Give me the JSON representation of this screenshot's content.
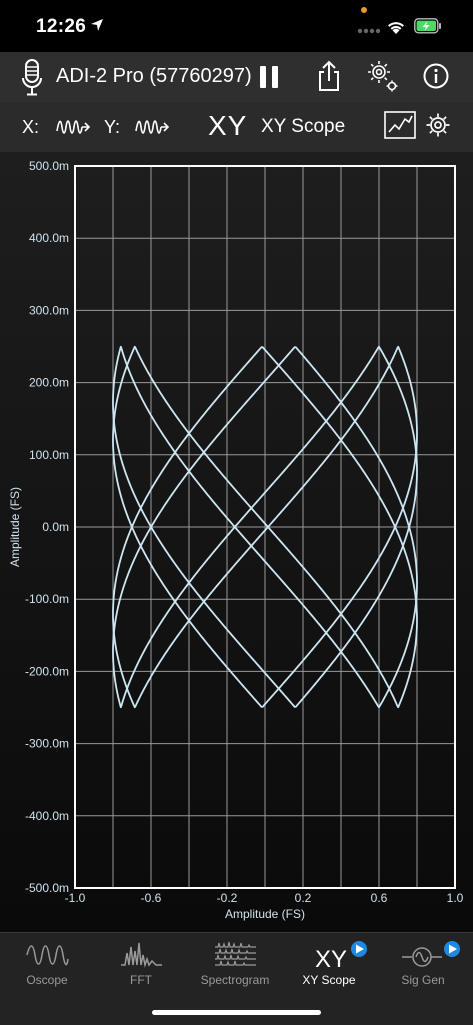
{
  "status_bar": {
    "time": "12:26"
  },
  "toolbar": {
    "device_title": "ADI-2 Pro (57760297)"
  },
  "scope_bar": {
    "x_label": "X:",
    "y_label": "Y:",
    "mode_short": "XY",
    "mode_name": "XY Scope"
  },
  "chart_data": {
    "type": "scatter",
    "title": "",
    "xlabel": "Amplitude (FS)",
    "ylabel": "Amplitude (FS)",
    "xlim": [
      -1.0,
      1.0
    ],
    "ylim": [
      -0.5,
      0.5
    ],
    "x_ticks": [
      -1.0,
      -0.8,
      -0.6,
      -0.4,
      -0.2,
      0.0,
      0.2,
      0.4,
      0.6,
      0.8,
      1.0
    ],
    "x_tick_labels": [
      "-1.0",
      "",
      "-0.6",
      "",
      "-0.2",
      "",
      "0.2",
      "",
      "0.6",
      "",
      "1.0"
    ],
    "y_ticks": [
      0.5,
      0.4,
      0.3,
      0.2,
      0.1,
      0.0,
      -0.1,
      -0.2,
      -0.3,
      -0.4,
      -0.5
    ],
    "y_tick_labels": [
      "500.0m",
      "400.0m",
      "300.0m",
      "200.0m",
      "100.0m",
      "0.0m",
      "-100.0m",
      "-200.0m",
      "-300.0m",
      "-400.0m",
      "-500.0m"
    ],
    "grid": true,
    "series": [
      {
        "x_amplitude": 0.8,
        "y_amplitude": 0.25,
        "frequency_ratio": 1.5,
        "phase_offsets": [
          0.3,
          1.6
        ],
        "color": "#cde6f2"
      }
    ]
  },
  "tabs": [
    {
      "label": "Oscope",
      "icon": "oscope-wave-icon",
      "active": false
    },
    {
      "label": "FFT",
      "icon": "fft-spectrum-icon",
      "active": false
    },
    {
      "label": "Spectrogram",
      "icon": "spectrogram-icon",
      "active": false
    },
    {
      "label": "XY Scope",
      "icon": "xy-scope-icon",
      "active": true,
      "badge_color": "#1e88e5"
    },
    {
      "label": "Sig Gen",
      "icon": "sig-gen-icon",
      "active": false,
      "badge_color": "#1e88e5"
    }
  ],
  "colors": {
    "trace": "#cde6f2",
    "grid": "#9a9a9a",
    "plot_frame": "#ffffff",
    "accent": "#1e88e5"
  }
}
